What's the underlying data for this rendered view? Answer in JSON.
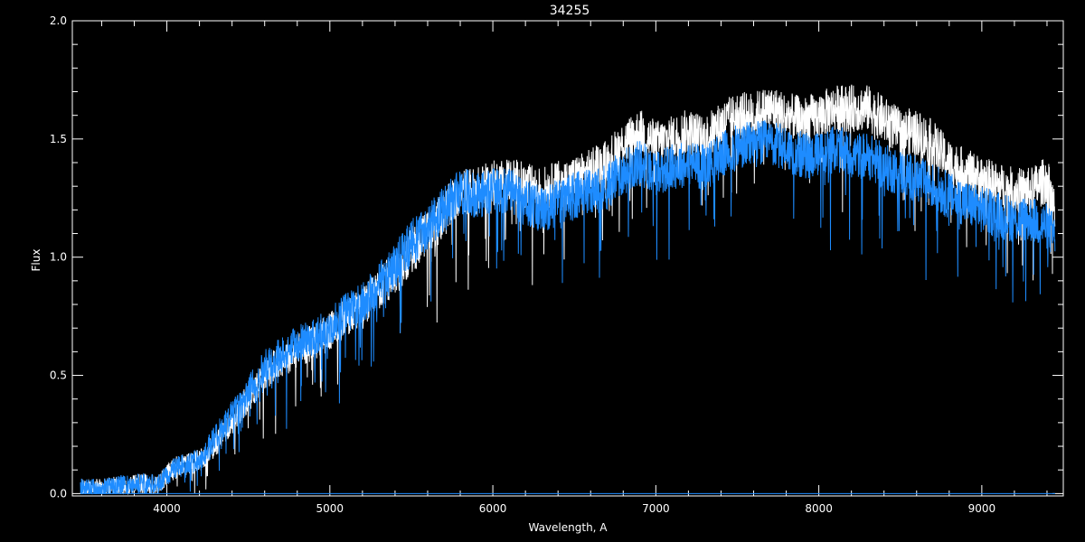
{
  "chart_data": {
    "type": "line",
    "title": "34255",
    "xlabel": "Wavelength, A",
    "ylabel": "Flux",
    "xlim": [
      3420,
      9500
    ],
    "ylim": [
      -0.01,
      2.0
    ],
    "x_ticks": [
      4000,
      5000,
      6000,
      7000,
      8000,
      9000
    ],
    "x_tick_labels": [
      "4000",
      "5000",
      "6000",
      "7000",
      "8000",
      "9000"
    ],
    "y_ticks": [
      0.0,
      0.5,
      1.0,
      1.5,
      2.0
    ],
    "y_tick_labels": [
      "0.0",
      "0.5",
      "1.0",
      "1.5",
      "2.0"
    ],
    "grid": false,
    "colors": {
      "background": "#000000",
      "axes": "#ffffff",
      "series_model": "#ffffff",
      "series_observed": "#1e8cff"
    },
    "series": [
      {
        "id": "model",
        "x": [
          3470,
          3600,
          3800,
          3950,
          4050,
          4200,
          4300,
          4400,
          4500,
          4600,
          4700,
          4800,
          4900,
          5000,
          5100,
          5200,
          5300,
          5400,
          5500,
          5600,
          5700,
          5800,
          5900,
          6000,
          6100,
          6200,
          6300,
          6400,
          6500,
          6600,
          6700,
          6800,
          6900,
          7000,
          7100,
          7200,
          7300,
          7400,
          7500,
          7600,
          7700,
          7800,
          7900,
          8000,
          8100,
          8200,
          8300,
          8400,
          8500,
          8600,
          8700,
          8800,
          8900,
          9000,
          9100,
          9200,
          9300,
          9400,
          9450
        ],
        "y": [
          0.03,
          0.03,
          0.05,
          0.05,
          0.12,
          0.15,
          0.22,
          0.32,
          0.42,
          0.52,
          0.58,
          0.62,
          0.66,
          0.7,
          0.76,
          0.8,
          0.88,
          0.95,
          1.05,
          1.12,
          1.2,
          1.3,
          1.3,
          1.33,
          1.35,
          1.32,
          1.3,
          1.33,
          1.35,
          1.38,
          1.42,
          1.5,
          1.55,
          1.5,
          1.52,
          1.55,
          1.52,
          1.58,
          1.62,
          1.62,
          1.65,
          1.62,
          1.6,
          1.62,
          1.65,
          1.65,
          1.65,
          1.6,
          1.55,
          1.55,
          1.5,
          1.42,
          1.38,
          1.35,
          1.32,
          1.3,
          1.3,
          1.35,
          1.2
        ]
      },
      {
        "id": "observed",
        "x": [
          3470,
          3600,
          3800,
          3950,
          4050,
          4200,
          4300,
          4400,
          4500,
          4600,
          4700,
          4800,
          4900,
          5000,
          5100,
          5200,
          5300,
          5400,
          5500,
          5600,
          5700,
          5800,
          5900,
          6000,
          6100,
          6200,
          6300,
          6400,
          6500,
          6600,
          6700,
          6800,
          6900,
          7000,
          7100,
          7200,
          7300,
          7400,
          7500,
          7600,
          7700,
          7800,
          7900,
          8000,
          8100,
          8200,
          8300,
          8400,
          8500,
          8600,
          8700,
          8800,
          8900,
          9000,
          9100,
          9200,
          9300,
          9400,
          9450
        ],
        "y": [
          0.03,
          0.03,
          0.05,
          0.05,
          0.12,
          0.15,
          0.25,
          0.35,
          0.45,
          0.55,
          0.6,
          0.65,
          0.68,
          0.72,
          0.78,
          0.82,
          0.9,
          0.98,
          1.08,
          1.15,
          1.22,
          1.3,
          1.28,
          1.3,
          1.3,
          1.25,
          1.22,
          1.25,
          1.28,
          1.3,
          1.32,
          1.38,
          1.42,
          1.38,
          1.4,
          1.42,
          1.4,
          1.45,
          1.48,
          1.5,
          1.5,
          1.48,
          1.45,
          1.45,
          1.48,
          1.45,
          1.45,
          1.4,
          1.38,
          1.35,
          1.32,
          1.28,
          1.25,
          1.22,
          1.2,
          1.18,
          1.18,
          1.15,
          1.1
        ]
      },
      {
        "id": "baseline",
        "x": [
          3470,
          9450
        ],
        "y": [
          0.0,
          0.0
        ]
      }
    ],
    "annotations": [
      {
        "x": 7600,
        "y": 2.0,
        "text": ""
      }
    ]
  }
}
